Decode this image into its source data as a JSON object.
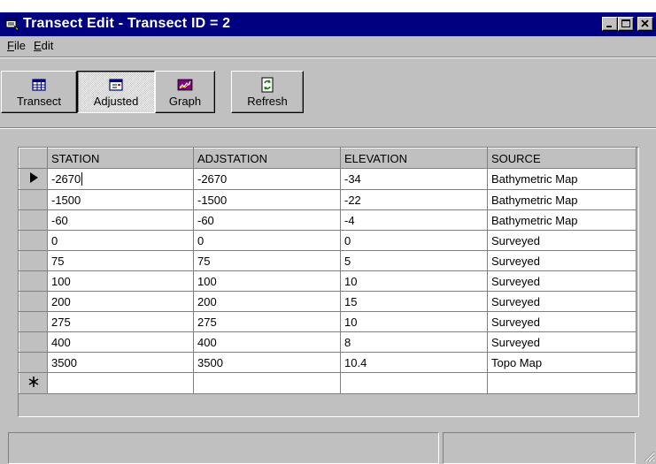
{
  "window": {
    "title": "Transect Edit - Transect ID = 2"
  },
  "menu": {
    "file": {
      "key": "F",
      "rest": "ile"
    },
    "edit": {
      "key": "E",
      "rest": "dit"
    }
  },
  "toolbar": {
    "transect_label": "Transect",
    "adjusted_label": "Adjusted",
    "graph_label": "Graph",
    "refresh_label": "Refresh",
    "pressed": "Adjusted"
  },
  "grid": {
    "columns": [
      "STATION",
      "ADJSTATION",
      "ELEVATION",
      "SOURCE"
    ],
    "rows": [
      [
        "-2670",
        "-2670",
        "-34",
        "Bathymetric Map"
      ],
      [
        "-1500",
        "-1500",
        "-22",
        "Bathymetric Map"
      ],
      [
        "-60",
        "-60",
        "-4",
        "Bathymetric Map"
      ],
      [
        "0",
        "0",
        "0",
        "Surveyed"
      ],
      [
        "75",
        "75",
        "5",
        "Surveyed"
      ],
      [
        "100",
        "100",
        "10",
        "Surveyed"
      ],
      [
        "200",
        "200",
        "15",
        "Surveyed"
      ],
      [
        "275",
        "275",
        "10",
        "Surveyed"
      ],
      [
        "400",
        "400",
        "8",
        "Surveyed"
      ],
      [
        "3500",
        "3500",
        "10.4",
        "Topo Map"
      ]
    ],
    "current_row_marker": "▶",
    "new_row_marker": "✱"
  },
  "icons": {
    "title": "form-icon",
    "transect": "table-icon",
    "adjusted": "form-view-icon",
    "graph": "graph-icon",
    "refresh": "refresh-icon"
  }
}
